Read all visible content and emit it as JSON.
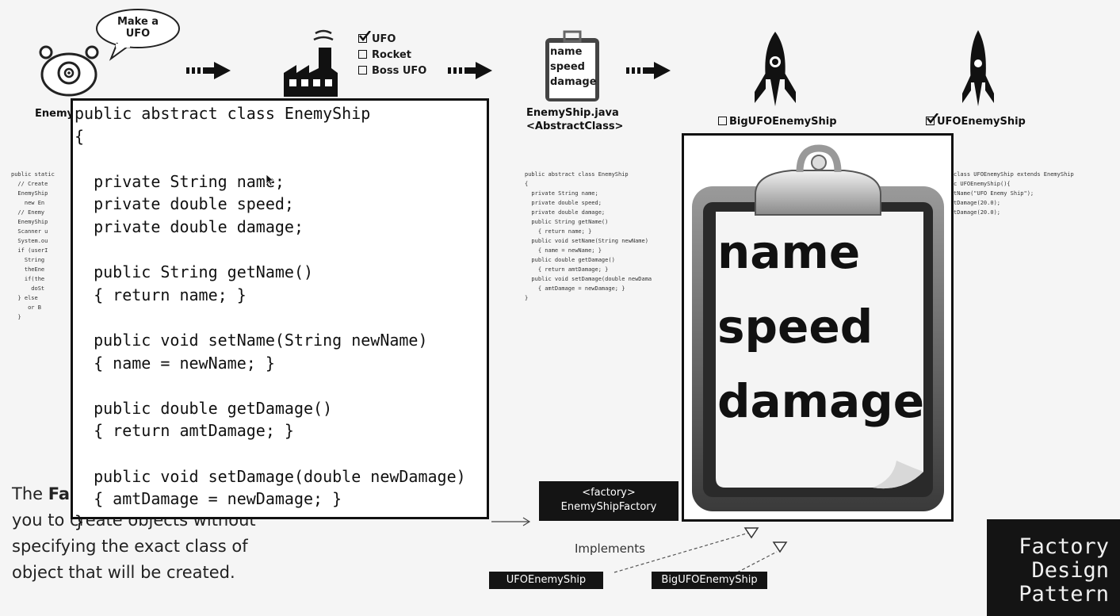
{
  "speech_bubble": [
    "Make a",
    "UFO"
  ],
  "client_label": "Enemy",
  "factory_options": [
    {
      "label": "UFO",
      "checked": true
    },
    {
      "label": "Rocket",
      "checked": false
    },
    {
      "label": "Boss UFO",
      "checked": false
    }
  ],
  "clipboard_small_lines": [
    "name",
    "speed",
    "damage"
  ],
  "abstract_title": "EnemyShip.java",
  "abstract_subtitle": "<AbstractClass>",
  "big_ufo_label": "BigUFOEnemyShip",
  "ufo_label": "UFOEnemyShip",
  "left_code_snippet": [
    "public static",
    "",
    "  // Create",
    "  EnemyShip",
    "    new En",
    "",
    "  // Enemy",
    "",
    "  EnemyShip",
    "",
    "  Scanner u",
    "",
    "  System.ou",
    "",
    "  if (userI",
    "",
    "    String",
    "",
    "    theEne",
    "",
    "    if(the",
    "",
    "      doSt",
    "",
    "  } else",
    "     or B",
    "",
    "  }"
  ],
  "middle_code_snippet": [
    "public abstract class EnemyShip",
    "{",
    "",
    "  private String name;",
    "  private double speed;",
    "  private double damage;",
    "",
    "  public String getName()",
    "    { return name; }",
    "  public void setName(String newName)",
    "    { name = newName; }",
    "",
    "  public double getDamage()",
    "    { return amtDamage; }",
    "  public void setDamage(double newDama",
    "    { amtDamage = newDamage; }",
    "}"
  ],
  "right_code_snippet": [
    "class UFOEnemyShip extends EnemyShip",
    "",
    "c UFOEnemyShip(){",
    "",
    "tName(\"UFO Enemy Ship\");",
    "tDamage(20.0);",
    "tDamage(20.0);"
  ],
  "code_popup_text": "public abstract class EnemyShip\n{\n\n  private String name;\n  private double speed;\n  private double damage;\n\n  public String getName()\n  { return name; }\n\n  public void setName(String newName)\n  { name = newName; }\n\n  public double getDamage()\n  { return amtDamage; }\n\n  public void setDamage(double newDamage)\n  { amtDamage = newDamage; }\n}",
  "clipboard_big_lines": [
    "name",
    "speed",
    "damage"
  ],
  "bottom_text": {
    "line1_prefix": "The ",
    "line1_bold": "Fa",
    "line2": "you to create objects without",
    "line3": "specifying the exact class of",
    "line4": "object that will be created."
  },
  "factory_box": {
    "stereotype": "<factory>",
    "name": "EnemyShipFactory"
  },
  "implements_label": "Implements",
  "ufo_box_label": "UFOEnemyShip",
  "big_box_label": "BigUFOEnemyShip",
  "corner_badge": [
    "Factory",
    "Design",
    "Pattern"
  ]
}
